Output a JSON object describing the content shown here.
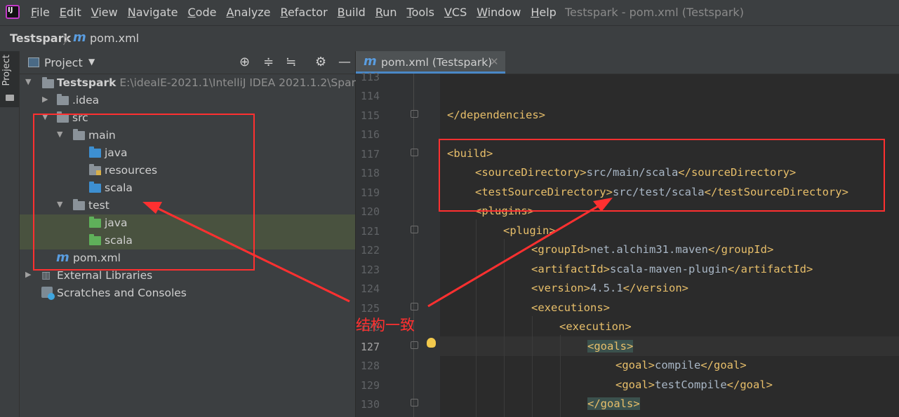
{
  "menubar": {
    "items": [
      "File",
      "Edit",
      "View",
      "Navigate",
      "Code",
      "Analyze",
      "Refactor",
      "Build",
      "Run",
      "Tools",
      "VCS",
      "Window",
      "Help"
    ],
    "window_title": "Testspark - pom.xml (Testspark)"
  },
  "breadcrumb": {
    "project": "Testspark",
    "file": "pom.xml"
  },
  "toolstrip": {
    "label": "Project"
  },
  "project_panel": {
    "title": "Project",
    "tree": {
      "root_name": "Testspark",
      "root_path": "E:\\idealE-2021.1\\IntelliJ IDEA 2021.1.2\\SparkProj",
      "idea": ".idea",
      "src": "src",
      "main": "main",
      "main_java": "java",
      "main_resources": "resources",
      "main_scala": "scala",
      "test": "test",
      "test_java": "java",
      "test_scala": "scala",
      "pom": "pom.xml",
      "external_libraries": "External Libraries",
      "scratches": "Scratches and Consoles"
    }
  },
  "editor": {
    "tab_label": "pom.xml (Testspark)",
    "line_numbers": [
      "113",
      "114",
      "115",
      "116",
      "117",
      "118",
      "119",
      "120",
      "121",
      "122",
      "123",
      "124",
      "125",
      "126",
      "127",
      "128",
      "129",
      "130"
    ],
    "current_line": "127",
    "lines": {
      "l115": "</dependencies>",
      "l117": "<build>",
      "l118_open": "<sourceDirectory>",
      "l118_text": "src/main/scala",
      "l118_close": "</sourceDirectory>",
      "l119_open": "<testSourceDirectory>",
      "l119_text": "src/test/scala",
      "l119_close": "</testSourceDirectory>",
      "l120": "<plugins>",
      "l121": "<plugin>",
      "l122_open": "<groupId>",
      "l122_text": "net.alchim31.maven",
      "l122_close": "</groupId>",
      "l123_open": "<artifactId>",
      "l123_text": "scala-maven-plugin",
      "l123_close": "</artifactId>",
      "l124_open": "<version>",
      "l124_text": "4.5.1",
      "l124_close": "</version>",
      "l125": "<executions>",
      "l126": "<execution>",
      "l127": "<goals>",
      "l128_open": "<goal>",
      "l128_text": "compile",
      "l128_close": "</goal>",
      "l129_open": "<goal>",
      "l129_text": "testCompile",
      "l129_close": "</goal>",
      "l130": "</goals>"
    }
  },
  "annotation": {
    "text": "结构一致"
  },
  "colors": {
    "highlight_red": "#ff3030",
    "tag": "#e8bf6a",
    "text": "#a9b7c6"
  }
}
